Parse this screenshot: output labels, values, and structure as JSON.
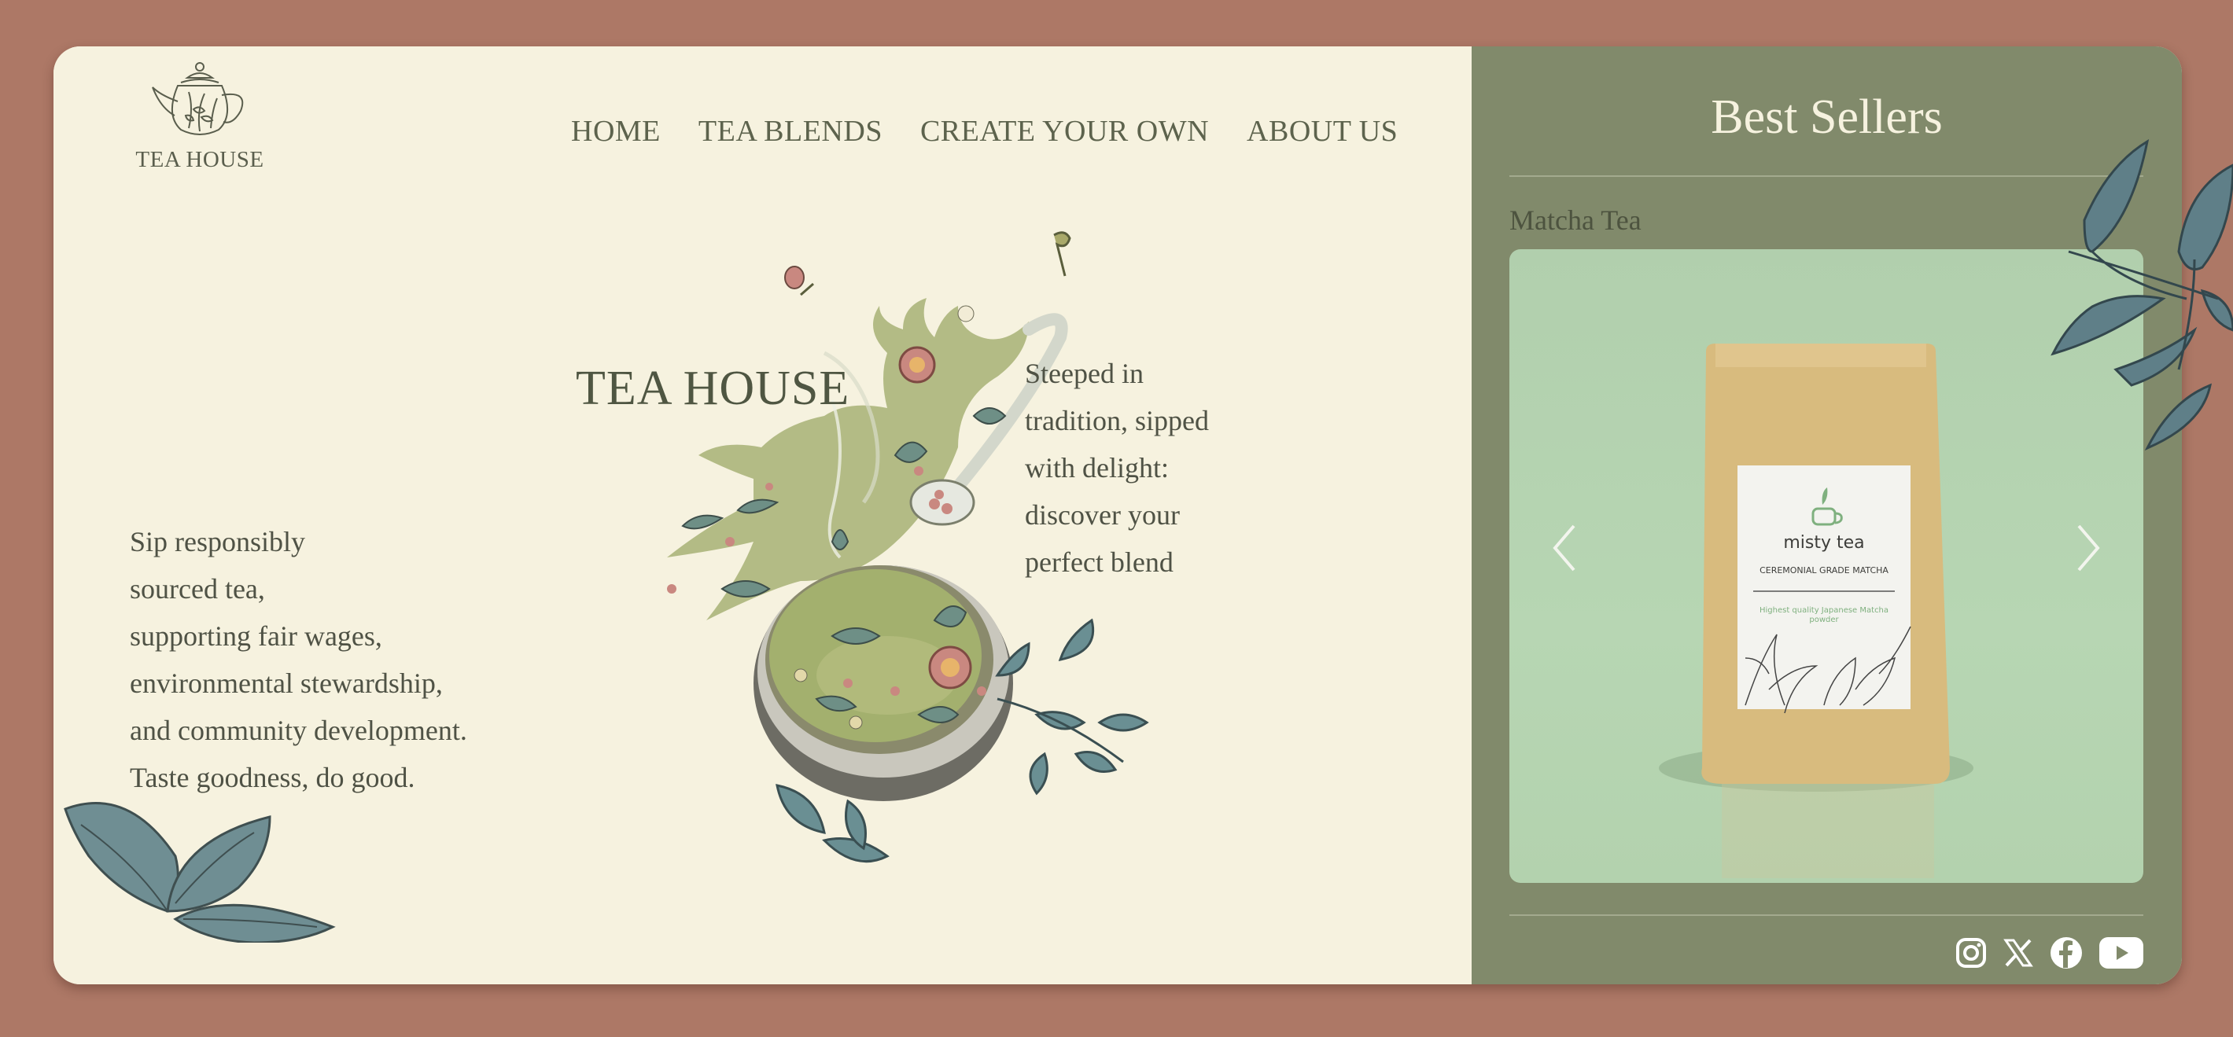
{
  "brand": {
    "logo_text": "TEA HOUSE"
  },
  "nav": {
    "items": [
      {
        "label": "HOME"
      },
      {
        "label": "TEA BLENDS"
      },
      {
        "label": "CREATE YOUR OWN"
      },
      {
        "label": "ABOUT US"
      }
    ]
  },
  "hero": {
    "title": "TEA HOUSE",
    "tagline_lines": [
      "Steeped in",
      "tradition, sipped",
      "with delight:",
      "discover your",
      "perfect blend"
    ],
    "mission_lines": [
      "Sip responsibly",
      "sourced tea,",
      "supporting fair wages,",
      "environmental stewardship,",
      "and community development.",
      "Taste goodness, do good."
    ]
  },
  "best_sellers": {
    "title": "Best Sellers",
    "product_name": "Matcha Tea",
    "package": {
      "brand": "misty tea",
      "line1": "CEREMONIAL GRADE MATCHA",
      "line2": "Highest quality Japanese Matcha",
      "line3": "powder"
    }
  },
  "icons": {
    "prev": "chevron-left-icon",
    "next": "chevron-right-icon",
    "social": [
      "instagram-icon",
      "x-icon",
      "facebook-icon",
      "youtube-icon"
    ]
  },
  "colors": {
    "background": "#ad7866",
    "card": "#f6f2df",
    "panel": "#818a6b",
    "text": "#4f5245",
    "carousel": "#b7d6b3"
  }
}
